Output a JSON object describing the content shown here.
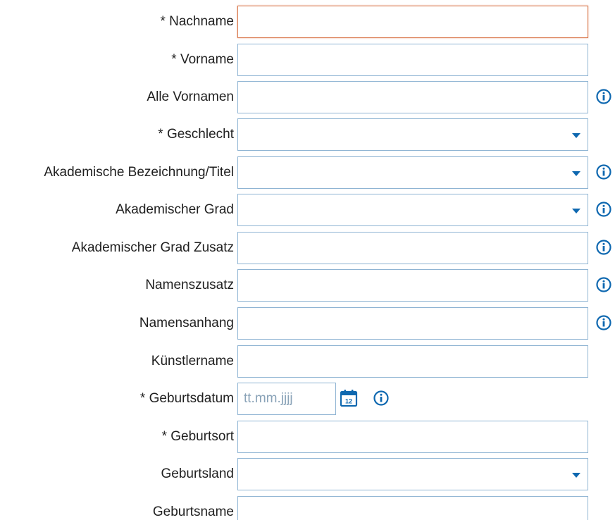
{
  "form": {
    "fields": [
      {
        "label": "* Nachname"
      },
      {
        "label": "* Vorname"
      },
      {
        "label": "Alle Vornamen"
      },
      {
        "label": "* Geschlecht"
      },
      {
        "label": "Akademische Bezeichnung/Titel"
      },
      {
        "label": "Akademischer Grad"
      },
      {
        "label": "Akademischer Grad Zusatz"
      },
      {
        "label": "Namenszusatz"
      },
      {
        "label": "Namensanhang"
      },
      {
        "label": "Künstlername"
      },
      {
        "label": "* Geburtsdatum",
        "placeholder": "tt.mm.jjjj",
        "calendar_day": "12"
      },
      {
        "label": "* Geburtsort"
      },
      {
        "label": "Geburtsland"
      },
      {
        "label": "Geburtsname"
      }
    ]
  },
  "icons": {
    "info": "info-icon",
    "calendar": "calendar-icon",
    "dropdown": "chevron-down-icon"
  },
  "colors": {
    "accent": "#0e68b0",
    "field_border": "#8fb4d3",
    "focus_border": "#d9774b"
  }
}
